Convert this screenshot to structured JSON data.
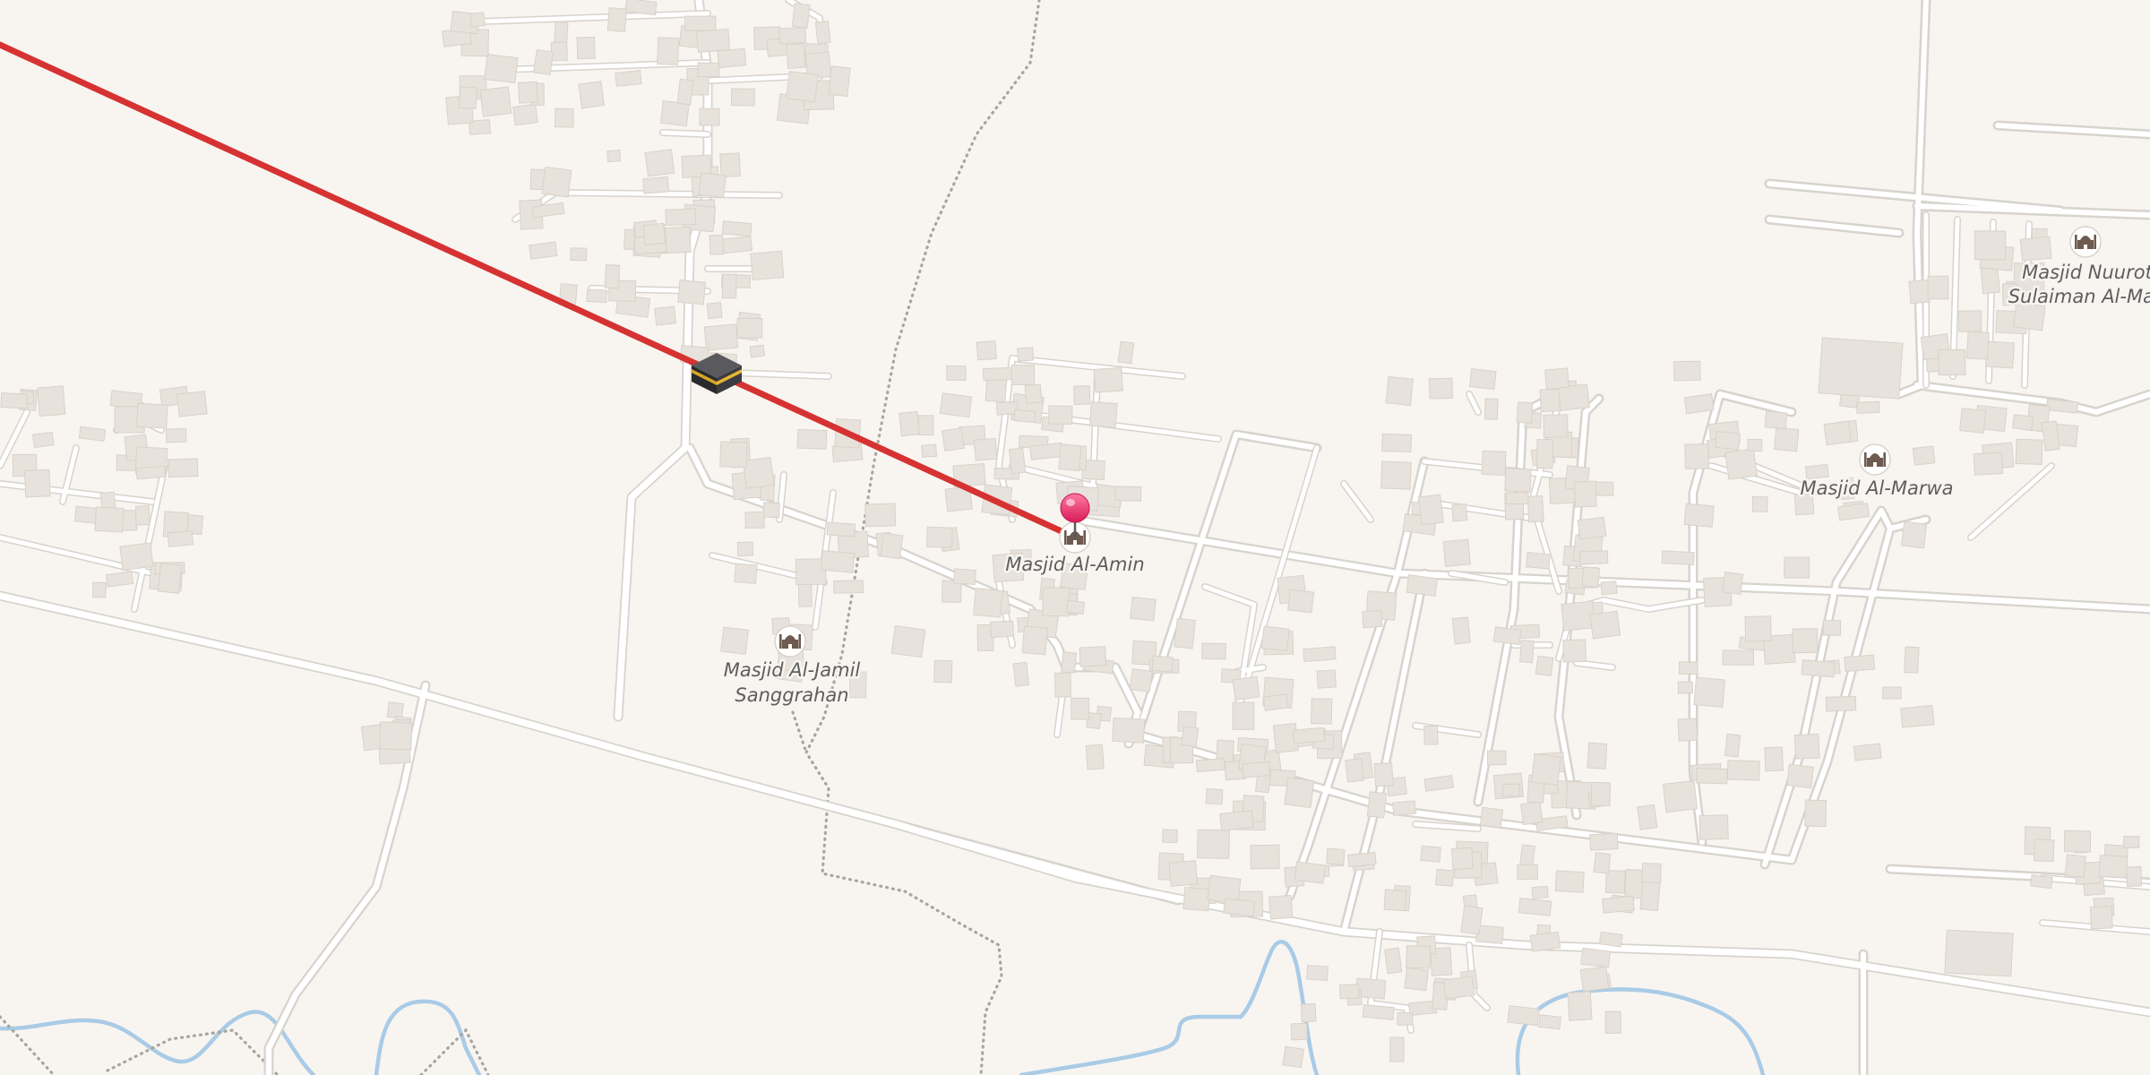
{
  "map": {
    "pois": [
      {
        "id": "al-amin",
        "lines": [
          "Masjid Al-Amin"
        ],
        "icon": "mosque-icon"
      },
      {
        "id": "al-jamil",
        "lines": [
          "Masjid Al-Jamil",
          "Sanggrahan"
        ],
        "icon": "mosque-icon"
      },
      {
        "id": "al-marwa",
        "lines": [
          "Masjid Al-Marwa"
        ],
        "icon": "mosque-icon"
      },
      {
        "id": "nuurot",
        "lines": [
          "Masjid Nuurot",
          "Sulaiman Al-Mad"
        ],
        "icon": "mosque-icon"
      }
    ],
    "selected_marker": {
      "icon": "location-pin-icon",
      "color": "#e8306a"
    },
    "kaaba_marker": {
      "icon": "kaaba-icon"
    },
    "qibla_line": {
      "color": "#d63232"
    },
    "colors": {
      "background": "#f8f5f1",
      "road": "#ffffff",
      "river": "#a9cbe6",
      "building": "#e8e2dc"
    }
  }
}
